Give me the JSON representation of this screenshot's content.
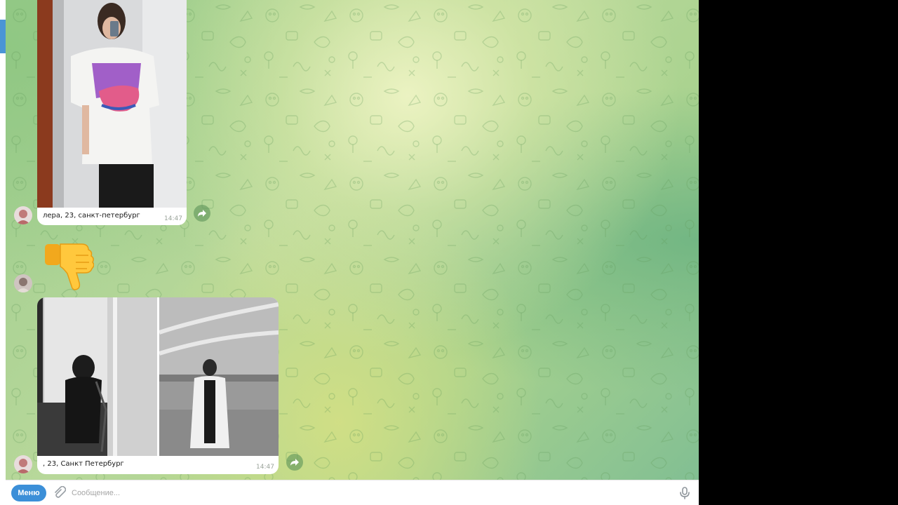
{
  "colors": {
    "accent": "#3c8fd8",
    "chat_bg_light": "#e8f0c4",
    "chat_bg_green": "#9ccc8e",
    "bubble": "#ffffff",
    "time_text": "#9aa39a",
    "outer_background": "#000000"
  },
  "messages": [
    {
      "type": "photo",
      "caption": "лера, 23, санкт-петербург",
      "time": "14:47",
      "icons": [
        "avatar",
        "forward-icon"
      ]
    },
    {
      "type": "sticker",
      "emoji": "👎",
      "icons": [
        "avatar",
        "thumbs-down-sticker"
      ]
    },
    {
      "type": "album",
      "photo_count": 2,
      "caption": ", 23, Санкт Петербург",
      "time": "14:47",
      "icons": [
        "avatar",
        "forward-icon"
      ]
    }
  ],
  "composer": {
    "menu_label": "Меню",
    "placeholder": "Сообщение...",
    "icons": [
      "attach-icon",
      "mic-icon"
    ]
  }
}
